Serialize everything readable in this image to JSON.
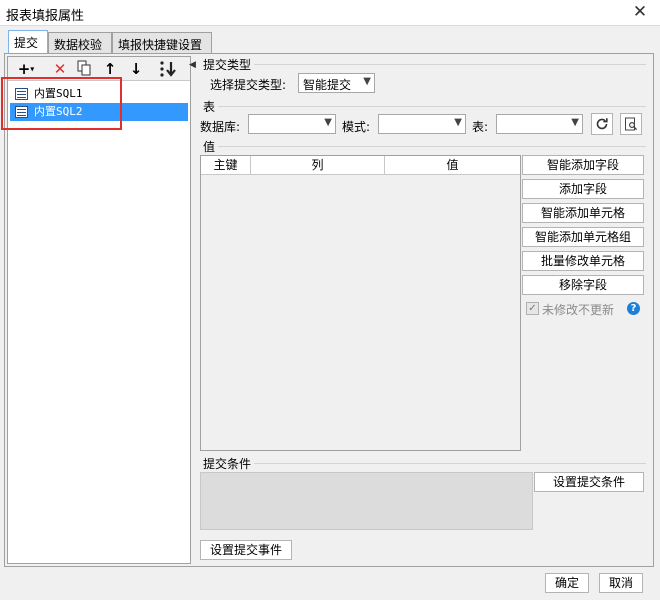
{
  "window": {
    "title": "报表填报属性",
    "close_glyph": "✕"
  },
  "tabs": [
    {
      "label": "提交",
      "active": true
    },
    {
      "label": "数据校验",
      "active": false
    },
    {
      "label": "填报快捷键设置",
      "active": false
    }
  ],
  "toolbar": {
    "add_icon": "plus-icon",
    "delete_icon": "delete-x-icon",
    "copy_icon": "copy-icon",
    "up_icon": "arrow-up-icon",
    "down_icon": "arrow-down-icon",
    "sort_icon": "sort-icon"
  },
  "tree": {
    "items": [
      {
        "label": "内置SQL1",
        "selected": false
      },
      {
        "label": "内置SQL2",
        "selected": true
      }
    ],
    "highlight_color": "#e0302d"
  },
  "submit_type": {
    "section_label": "提交类型",
    "select_label": "选择提交类型:",
    "select_value": "智能提交"
  },
  "table_section": {
    "section_label": "表",
    "db_label": "数据库:",
    "db_value": "",
    "schema_label": "模式:",
    "schema_value": "",
    "table_label": "表:",
    "table_value": "",
    "refresh_icon": "refresh-icon",
    "search_icon": "search-icon"
  },
  "values_section": {
    "section_label": "值",
    "columns": [
      "主键",
      "列",
      "值"
    ],
    "rows": []
  },
  "side_buttons": {
    "smart_add_field": "智能添加字段",
    "add_field": "添加字段",
    "smart_add_cell": "智能添加单元格",
    "smart_add_cell_group": "智能添加单元格组",
    "batch_modify_cell": "批量修改单元格",
    "remove_field": "移除字段",
    "unmodified_no_update": "未修改不更新",
    "unmodified_checked": true,
    "help_glyph": "?"
  },
  "condition_section": {
    "section_label": "提交条件",
    "set_condition_button": "设置提交条件",
    "set_event_button": "设置提交事件"
  },
  "footer": {
    "ok": "确定",
    "cancel": "取消"
  },
  "colors": {
    "selection": "#3399ff",
    "accent": "#1e7fd8"
  }
}
